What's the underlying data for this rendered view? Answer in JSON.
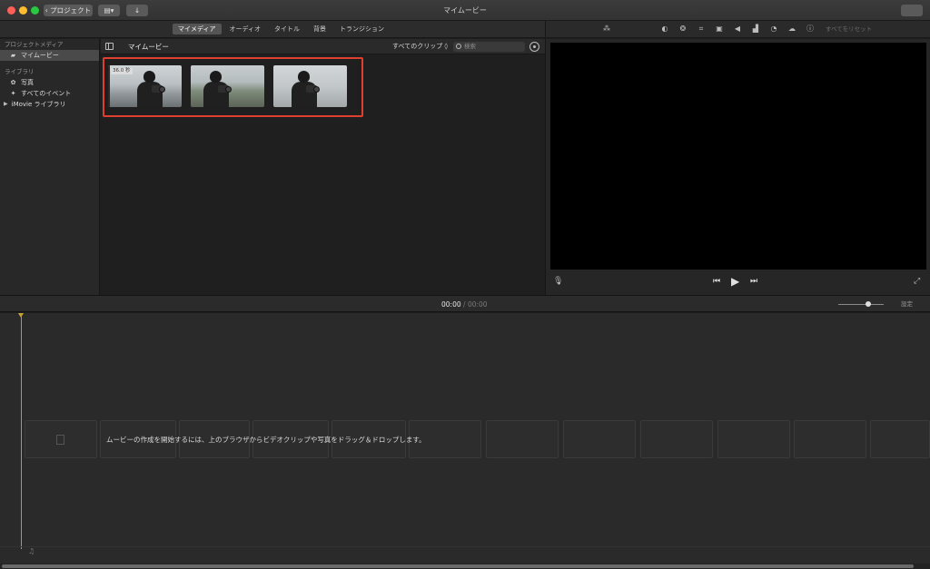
{
  "window": {
    "title": "マイムービー",
    "back_button": "‹ プロジェクト",
    "film_icon": "film-icon",
    "import_icon": "import-arrow-icon"
  },
  "tabs": [
    {
      "label": "マイメディア",
      "active": true
    },
    {
      "label": "オーディオ",
      "active": false
    },
    {
      "label": "タイトル",
      "active": false
    },
    {
      "label": "背景",
      "active": false
    },
    {
      "label": "トランジション",
      "active": false
    }
  ],
  "sidebar": {
    "project_media_header": "プロジェクトメディア",
    "project_item": "マイムービー",
    "library_header": "ライブラリ",
    "items": [
      {
        "label": "写真",
        "icon": "flower-icon"
      },
      {
        "label": "すべてのイベント",
        "icon": "star-icon"
      }
    ],
    "imovie_library": "iMovie ライブラリ"
  },
  "browser": {
    "title": "マイムービー",
    "filter": "すべてのクリップ ◊",
    "search_placeholder": "検索",
    "clips": [
      {
        "label": "36.0 秒"
      },
      {
        "label": ""
      },
      {
        "label": ""
      }
    ]
  },
  "viewer_toolbar": {
    "reset_label": "すべてをリセット",
    "icons": [
      "magic-wand-icon",
      "color-balance-icon",
      "color-palette-icon",
      "crop-icon",
      "stabilization-icon",
      "volume-icon",
      "equalizer-icon",
      "speed-icon",
      "filter-icon",
      "info-icon"
    ]
  },
  "timeline": {
    "current_time": "00:00",
    "separator": "/",
    "duration": "00:00",
    "settings_label": "設定",
    "zoom_level": 0.6,
    "drop_hint": "ムービーの作成を開始するには、上のブラウザからビデオクリップや写真をドラッグ＆ドロップします。"
  },
  "colors": {
    "highlight": "#e0412e",
    "playhead": "#b49a3a"
  }
}
